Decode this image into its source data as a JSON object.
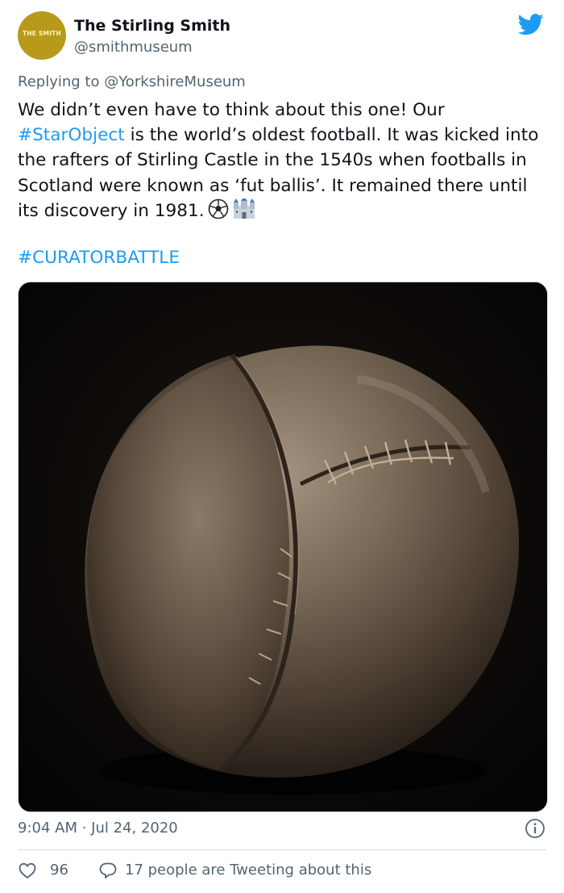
{
  "account": {
    "display_name": "The Stirling Smith",
    "handle": "@smithmuseum",
    "avatar_logo_text": "THE SMITH"
  },
  "reply": {
    "prefix": "Replying to ",
    "mention": "@YorkshireMuseum"
  },
  "body": {
    "text_1": "We didn’t even have to think about this one! Our ",
    "hashtag_1": "#StarObject",
    "text_2": " is the world’s oldest football. It was kicked into the rafters of Stirling Castle in the 1540s when footballs in Scotland were known as ‘fut ballis’. It remained there until its discovery in 1981.",
    "emojis": [
      "soccer-ball-icon",
      "castle-icon"
    ],
    "hashtag_2": "#CURATORBATTLE"
  },
  "media": {
    "description_icon": "photo-of-old-football"
  },
  "meta": {
    "timestamp": "9:04 AM · Jul 24, 2020"
  },
  "actions": {
    "likes": "96",
    "tweeting": "17 people are Tweeting about this"
  },
  "colors": {
    "link": "#1d9bf0",
    "muted": "#536471",
    "text": "#0f1419",
    "avatar": "#b79a1a"
  }
}
